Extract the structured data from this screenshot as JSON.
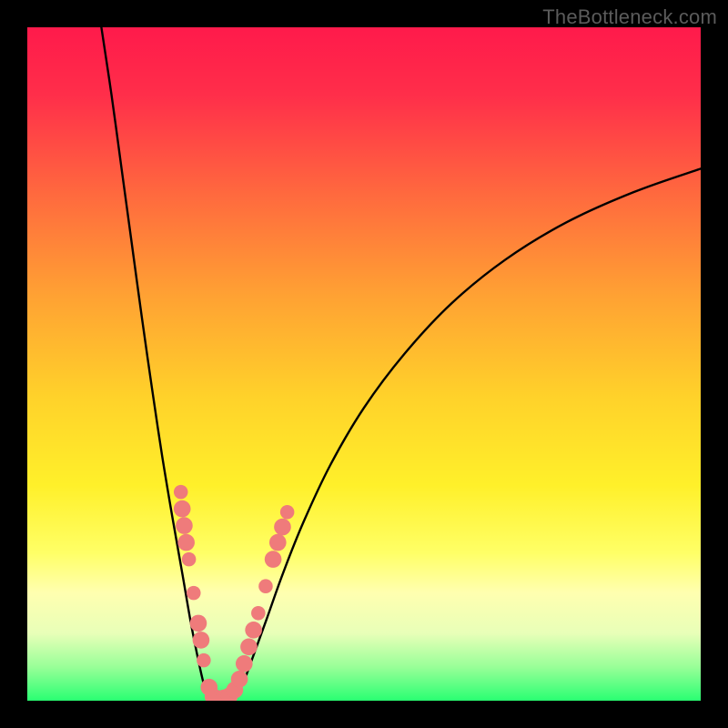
{
  "watermark": "TheBottleneck.com",
  "colors": {
    "frame": "#000000",
    "gradient_stops": [
      {
        "offset": 0.0,
        "color": "#ff1a4b"
      },
      {
        "offset": 0.1,
        "color": "#ff2e4a"
      },
      {
        "offset": 0.25,
        "color": "#ff6a3e"
      },
      {
        "offset": 0.4,
        "color": "#ffa233"
      },
      {
        "offset": 0.55,
        "color": "#ffd22a"
      },
      {
        "offset": 0.68,
        "color": "#fff02a"
      },
      {
        "offset": 0.78,
        "color": "#ffff66"
      },
      {
        "offset": 0.84,
        "color": "#ffffb0"
      },
      {
        "offset": 0.9,
        "color": "#e8ffb8"
      },
      {
        "offset": 0.95,
        "color": "#98ff98"
      },
      {
        "offset": 1.0,
        "color": "#29ff72"
      }
    ],
    "curve": "#000000",
    "marker_fill": "#ef7b7b",
    "marker_stroke": "#ef7b7b"
  },
  "chart_data": {
    "type": "line",
    "title": "",
    "xlabel": "",
    "ylabel": "",
    "xlim": [
      0,
      100
    ],
    "ylim": [
      0,
      100
    ],
    "series": [
      {
        "name": "left-branch",
        "x": [
          11.0,
          12.5,
          14.0,
          15.5,
          17.0,
          18.5,
          20.0,
          21.5,
          23.0,
          24.3,
          25.4,
          26.2,
          26.9
        ],
        "y": [
          100.0,
          90.0,
          79.0,
          68.0,
          57.0,
          46.5,
          36.5,
          27.5,
          19.0,
          11.5,
          6.0,
          2.5,
          0.4
        ]
      },
      {
        "name": "valley-floor",
        "x": [
          26.9,
          27.6,
          28.4,
          29.2,
          30.0,
          30.8
        ],
        "y": [
          0.4,
          0.0,
          0.0,
          0.0,
          0.1,
          0.5
        ]
      },
      {
        "name": "right-branch",
        "x": [
          30.8,
          32.0,
          33.5,
          35.5,
          38.0,
          41.0,
          45.0,
          50.0,
          56.0,
          63.0,
          71.0,
          80.0,
          90.0,
          100.0
        ],
        "y": [
          0.5,
          2.5,
          6.5,
          12.0,
          19.0,
          26.5,
          35.0,
          43.5,
          51.5,
          59.0,
          65.5,
          71.0,
          75.5,
          79.0
        ]
      }
    ],
    "markers": {
      "name": "highlighted-points",
      "points": [
        {
          "x": 22.8,
          "y": 31.0,
          "r": 1.0
        },
        {
          "x": 23.0,
          "y": 28.5,
          "r": 1.2
        },
        {
          "x": 23.3,
          "y": 26.0,
          "r": 1.2
        },
        {
          "x": 23.6,
          "y": 23.5,
          "r": 1.2
        },
        {
          "x": 24.0,
          "y": 21.0,
          "r": 1.0
        },
        {
          "x": 24.7,
          "y": 16.0,
          "r": 1.0
        },
        {
          "x": 25.4,
          "y": 11.5,
          "r": 1.2
        },
        {
          "x": 25.8,
          "y": 9.0,
          "r": 1.2
        },
        {
          "x": 26.2,
          "y": 6.0,
          "r": 1.0
        },
        {
          "x": 27.0,
          "y": 2.0,
          "r": 1.2
        },
        {
          "x": 27.6,
          "y": 0.6,
          "r": 1.2
        },
        {
          "x": 28.4,
          "y": 0.3,
          "r": 1.2
        },
        {
          "x": 29.2,
          "y": 0.4,
          "r": 1.2
        },
        {
          "x": 30.0,
          "y": 0.7,
          "r": 1.2
        },
        {
          "x": 30.8,
          "y": 1.6,
          "r": 1.2
        },
        {
          "x": 31.5,
          "y": 3.2,
          "r": 1.2
        },
        {
          "x": 32.2,
          "y": 5.5,
          "r": 1.2
        },
        {
          "x": 32.9,
          "y": 8.0,
          "r": 1.2
        },
        {
          "x": 33.6,
          "y": 10.5,
          "r": 1.2
        },
        {
          "x": 34.3,
          "y": 13.0,
          "r": 1.0
        },
        {
          "x": 35.4,
          "y": 17.0,
          "r": 1.0
        },
        {
          "x": 36.5,
          "y": 21.0,
          "r": 1.2
        },
        {
          "x": 37.2,
          "y": 23.5,
          "r": 1.2
        },
        {
          "x": 37.9,
          "y": 25.8,
          "r": 1.2
        },
        {
          "x": 38.6,
          "y": 28.0,
          "r": 1.0
        }
      ]
    }
  }
}
